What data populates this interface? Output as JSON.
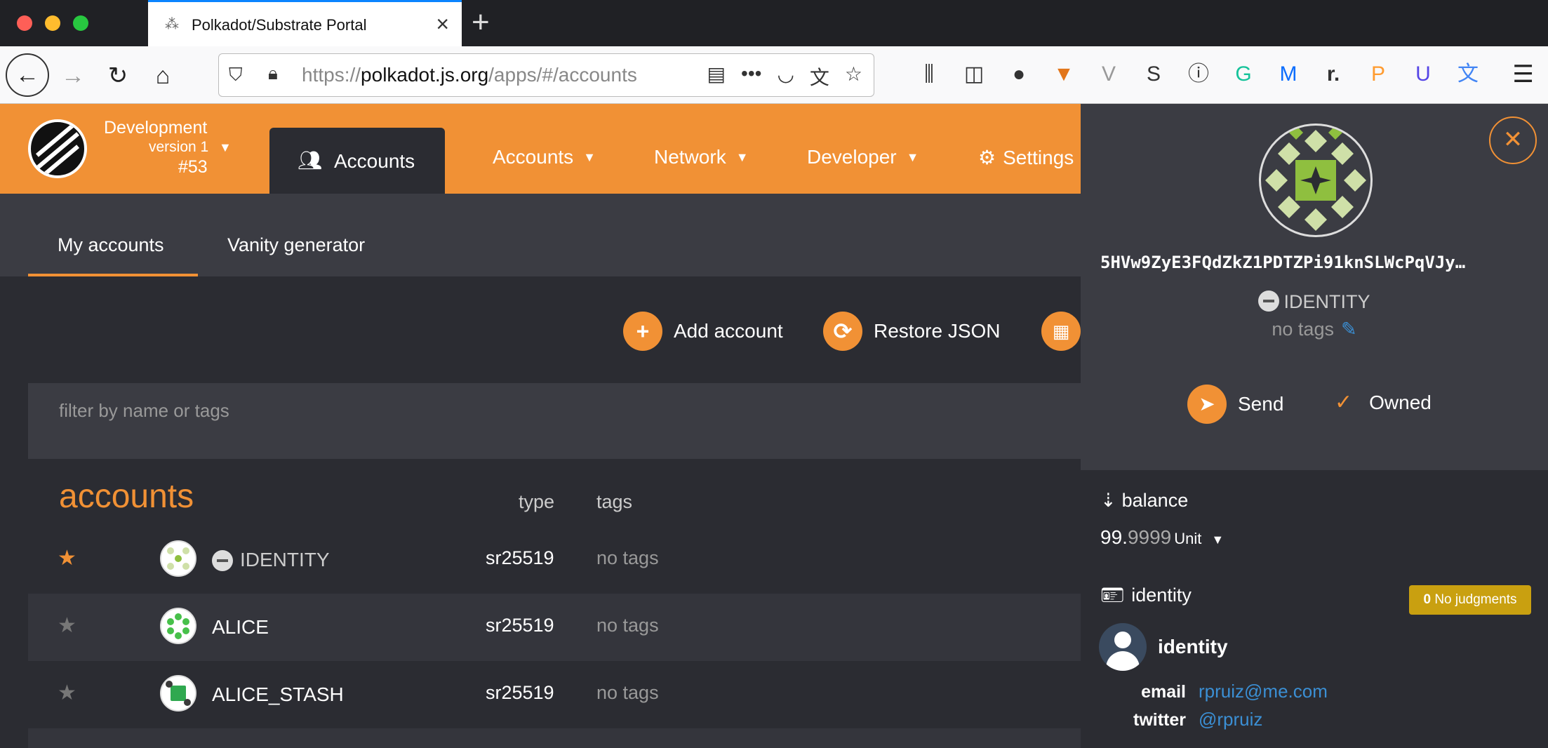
{
  "browser": {
    "tab_title": "Polkadot/Substrate Portal",
    "url_prefix": "https://",
    "url_host": "polkadot.js.org",
    "url_path": "/apps/#/accounts"
  },
  "header": {
    "chain_name": "Development",
    "chain_version": "version 1",
    "chain_block": "#53",
    "active_tab": "Accounts",
    "menus": [
      "Accounts",
      "Network",
      "Developer",
      "Settings"
    ]
  },
  "subtabs": [
    "My accounts",
    "Vanity generator"
  ],
  "actions": {
    "add": "Add account",
    "restore": "Restore JSON"
  },
  "filter": {
    "placeholder": "filter by name or tags"
  },
  "accounts": {
    "title": "accounts",
    "col_type": "type",
    "col_tags": "tags",
    "rows": [
      {
        "name": "IDENTITY",
        "type": "sr25519",
        "tags": "no tags"
      },
      {
        "name": "ALICE",
        "type": "sr25519",
        "tags": "no tags"
      },
      {
        "name": "ALICE_STASH",
        "type": "sr25519",
        "tags": "no tags"
      }
    ]
  },
  "sidebar": {
    "address": "5HVw9ZyE3FQdZkZ1PDTZPi91knSLWcPqVJy…",
    "identity_name": "IDENTITY",
    "tags": "no tags",
    "send": "Send",
    "owned": "Owned",
    "balance_label": "balance",
    "balance_int": "99.",
    "balance_dec": "9999",
    "balance_unit": "Unit",
    "identity_label": "identity",
    "judgment_count": "0",
    "judgment_text": "No judgments",
    "display": "identity",
    "email_label": "email",
    "email": "rpruiz@me.com",
    "twitter_label": "twitter",
    "twitter": "@rpruiz"
  },
  "colors": {
    "accent": "#f19135",
    "bg": "#2b2c32",
    "panel": "#3b3c43",
    "link": "#3b8fd4",
    "judgment": "#c9a010"
  }
}
